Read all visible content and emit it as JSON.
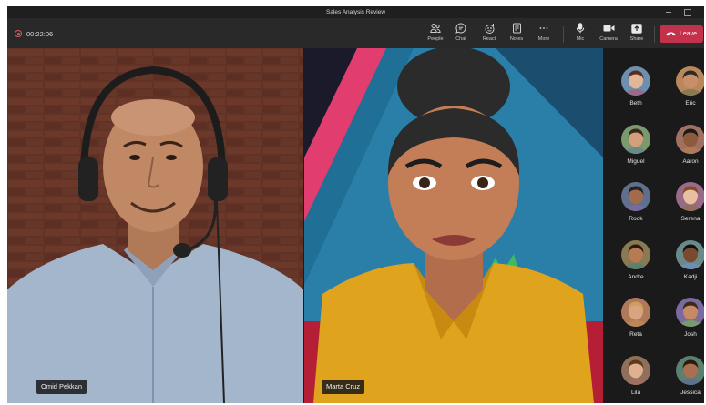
{
  "window": {
    "title": "Sales Analysis Review"
  },
  "call": {
    "duration": "00:22:06"
  },
  "toolbar": {
    "people": "People",
    "chat": "Chat",
    "react": "React",
    "notes": "Notes",
    "more": "More",
    "mic": "Mic",
    "camera": "Camera",
    "share": "Share",
    "leave": "Leave"
  },
  "stage": {
    "main_participants": [
      {
        "name": "Omid Pekkan"
      },
      {
        "name": "Marta Cruz"
      }
    ]
  },
  "roster": {
    "participants": [
      {
        "name": "Beth"
      },
      {
        "name": "Eric"
      },
      {
        "name": "Miguel"
      },
      {
        "name": "Aaron"
      },
      {
        "name": "Rook"
      },
      {
        "name": "Serena"
      },
      {
        "name": "Andre"
      },
      {
        "name": "Kadji"
      },
      {
        "name": "Reta"
      },
      {
        "name": "Josh"
      },
      {
        "name": "Lila"
      },
      {
        "name": "Jessica"
      }
    ]
  },
  "colors": {
    "leave_button": "#c4314b",
    "toolbar_bg": "#292929",
    "window_bg": "#1b1b1b",
    "recording": "#e05a64"
  }
}
